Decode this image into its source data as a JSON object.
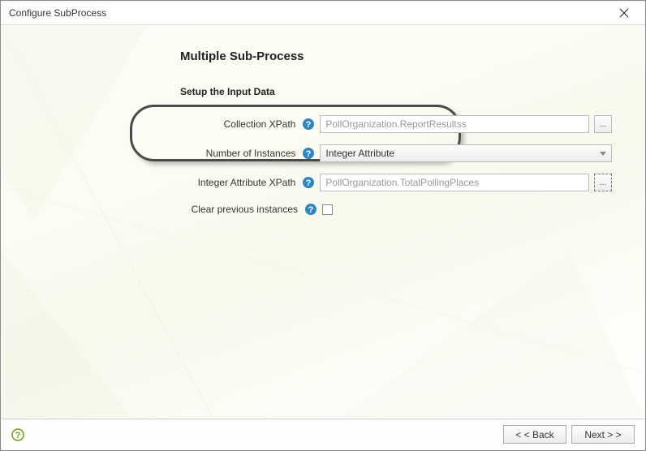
{
  "window": {
    "title": "Configure SubProcess"
  },
  "page": {
    "heading": "Multiple Sub-Process",
    "section": "Setup the Input Data"
  },
  "form": {
    "collection": {
      "label": "Collection XPath",
      "placeholder": "PollOrganization.ReportResultss",
      "value": ""
    },
    "instances": {
      "label": "Number of Instances",
      "selected": "Integer Attribute"
    },
    "integerAttr": {
      "label": "Integer Attribute XPath",
      "placeholder": "PollOrganization.TotalPollingPlaces",
      "value": ""
    },
    "clear": {
      "label": "Clear previous instances",
      "checked": false
    }
  },
  "footer": {
    "back": "< < Back",
    "next": "Next > >"
  },
  "icons": {
    "ellipsis": "..."
  }
}
